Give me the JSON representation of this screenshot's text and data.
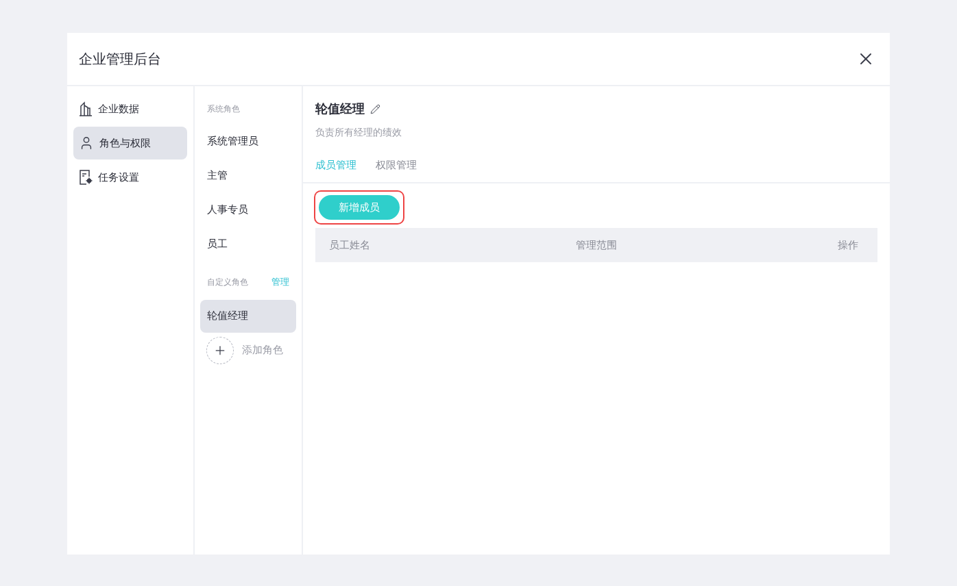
{
  "window": {
    "title": "企业管理后台"
  },
  "sidebar": {
    "items": [
      {
        "kind": "chart",
        "label": "企业数据",
        "selected": false
      },
      {
        "kind": "person",
        "label": "角色与权限",
        "selected": true
      },
      {
        "kind": "task",
        "label": "任务设置",
        "selected": false
      }
    ]
  },
  "roles": {
    "system_heading": "系统角色",
    "system_roles": [
      {
        "label": "系统管理员",
        "selected": false
      },
      {
        "label": "主管",
        "selected": false
      },
      {
        "label": "人事专员",
        "selected": false
      },
      {
        "label": "员工",
        "selected": false
      }
    ],
    "custom_heading": "自定义角色",
    "manage_link": "管理",
    "custom_roles": [
      {
        "label": "轮值经理",
        "selected": true
      }
    ],
    "add_role": "添加角色"
  },
  "detail": {
    "title": "轮值经理",
    "description": "负责所有经理的绩效",
    "tabs": [
      {
        "label": "成员管理",
        "selected": true
      },
      {
        "label": "权限管理",
        "selected": false
      }
    ],
    "add_button": {
      "label": "新增成员",
      "highlighted": true
    },
    "table": {
      "columns": [
        "员工姓名",
        "管理范围",
        "操作"
      ]
    }
  }
}
